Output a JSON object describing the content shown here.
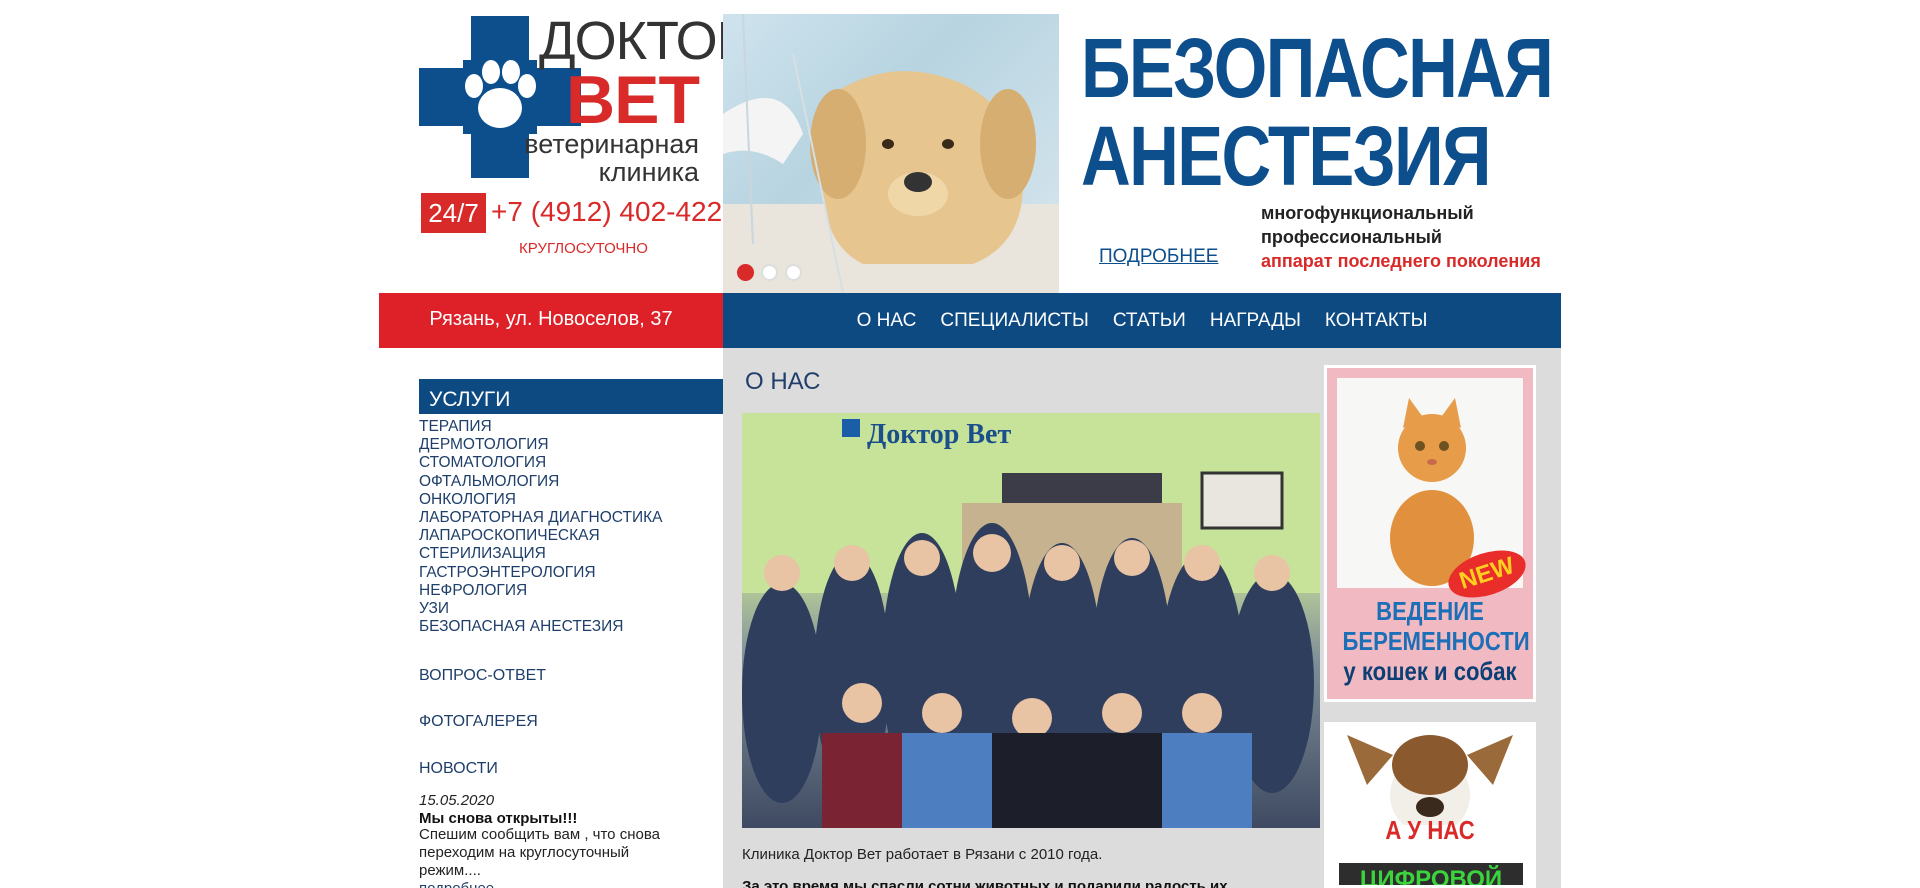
{
  "logo": {
    "word1": "ДОКТОР",
    "word2": "ВЕТ",
    "word3_line1": "ветеринарная",
    "word3_line2": "клиника"
  },
  "contact": {
    "badge": "24/7",
    "phone": "+7 (4912) 402-422",
    "hours": "КРУГЛОСУТОЧНО",
    "address": "Рязань, ул. Новоселов, 37"
  },
  "banner": {
    "headline_line1": "БЕЗОПАСНАЯ",
    "headline_line2": "АНЕСТЕЗИЯ",
    "sub1": "многофункциональный",
    "sub2": "профессиональный",
    "sub3": "аппарат последнего поколения",
    "more_link": "ПОДРОБНЕЕ",
    "slides_total": 3,
    "slide_active": 1
  },
  "nav": {
    "items": [
      "О НАС",
      "СПЕЦИАЛИСТЫ",
      "СТАТЬИ",
      "НАГРАДЫ",
      "КОНТАКТЫ"
    ]
  },
  "sidebar": {
    "services_title": "УСЛУГИ",
    "services": [
      "ТЕРАПИЯ",
      "ДЕРМОТОЛОГИЯ",
      "СТОМАТОЛОГИЯ",
      "ОФТАЛЬМОЛОГИЯ",
      "ОНКОЛОГИЯ",
      "ЛАБОРАТОРНАЯ ДИАГНОСТИКА",
      "ЛАПАРОСКОПИЧЕСКАЯ",
      "СТЕРИЛИЗАЦИЯ",
      "ГАСТРОЭНТЕРОЛОГИЯ",
      "НЕФРОЛОГИЯ",
      "УЗИ",
      "БЕЗОПАСНАЯ АНЕСТЕЗИЯ"
    ],
    "faq": "ВОПРОС-ОТВЕТ",
    "gallery": "ФОТОГАЛЕРЕЯ",
    "news_title": "НОВОСТИ",
    "news": {
      "date": "15.05.2020",
      "title": "Мы снова открыты!!!",
      "text": "Спешим сообщить вам , что снова переходим на круглосуточный режим....",
      "more": "подробнее"
    }
  },
  "main": {
    "title": "О НАС",
    "photo_sign": "Доктор Вет",
    "intro": "Клиника Доктор Вет работает в Рязани с 2010 года.",
    "intro2": "За это время мы спасли сотни животных и подарили радость их"
  },
  "ads": {
    "ad1": {
      "badge": "NEW",
      "line1": "ВЕДЕНИЕ",
      "line2": "БЕРЕМЕННОСТИ",
      "line3": "у кошек и собак"
    },
    "ad2": {
      "line1": "А У НАС",
      "line2": "ЦИФРОВОЙ"
    }
  },
  "colors": {
    "brand_blue": "#0d4a82",
    "brand_red": "#de2128",
    "main_bg": "#dcdcdc"
  }
}
